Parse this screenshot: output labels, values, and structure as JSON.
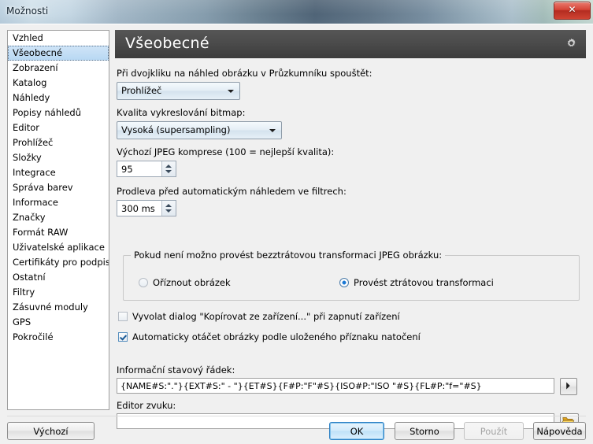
{
  "window": {
    "title": "Možnosti",
    "close_label": "✕",
    "close_icon": "close-icon"
  },
  "sidebar": {
    "items": [
      {
        "label": "Vzhled",
        "selected": false
      },
      {
        "label": "Všeobecné",
        "selected": true
      },
      {
        "label": "Zobrazení",
        "selected": false
      },
      {
        "label": "Katalog",
        "selected": false
      },
      {
        "label": "Náhledy",
        "selected": false
      },
      {
        "label": "Popisy náhledů",
        "selected": false
      },
      {
        "label": "Editor",
        "selected": false
      },
      {
        "label": "Prohlížeč",
        "selected": false
      },
      {
        "label": "Složky",
        "selected": false
      },
      {
        "label": "Integrace",
        "selected": false
      },
      {
        "label": "Správa barev",
        "selected": false
      },
      {
        "label": "Informace",
        "selected": false
      },
      {
        "label": "Značky",
        "selected": false
      },
      {
        "label": "Formát RAW",
        "selected": false
      },
      {
        "label": "Uživatelské aplikace",
        "selected": false
      },
      {
        "label": "Certifikáty pro podpis",
        "selected": false
      },
      {
        "label": "Ostatní",
        "selected": false
      },
      {
        "label": "Filtry",
        "selected": false
      },
      {
        "label": "Zásuvné moduly",
        "selected": false
      },
      {
        "label": "GPS",
        "selected": false
      },
      {
        "label": "Pokročilé",
        "selected": false
      }
    ]
  },
  "panel": {
    "title": "Všeobecné",
    "gear_icon": "gear-icon",
    "doubleclick": {
      "label": "Při dvojkliku na náhled obrázku v Průzkumníku spouštět:",
      "value": "Prohlížeč"
    },
    "bitmap_quality": {
      "label": "Kvalita vykreslování bitmap:",
      "value": "Vysoká (supersampling)"
    },
    "jpeg_compression": {
      "label": "Výchozí JPEG komprese (100 = nejlepší kvalita):",
      "value": "95"
    },
    "filter_delay": {
      "label": "Prodleva před automatickým náhledem ve filtrech:",
      "value": "300 ms"
    },
    "lossless_group": {
      "title": "Pokud není možno provést bezztrátovou transformaci JPEG obrázku:",
      "options": [
        {
          "label": "Oříznout obrázek",
          "selected": false
        },
        {
          "label": "Provést ztrátovou transformaci",
          "selected": true
        }
      ]
    },
    "checkboxes": [
      {
        "label": "Vyvolat dialog \"Kopírovat ze zařízení...\" při zapnutí zařízení",
        "checked": false
      },
      {
        "label": "Automaticky otáčet obrázky podle uloženého příznaku natočení",
        "checked": true
      }
    ],
    "status_line": {
      "label": "Informační stavový řádek:",
      "value": "{NAME#S:\".\"}{EXT#S:\" - \"}{ET#S}{F#P:\"F\"#S}{ISO#P:\"ISO \"#S}{FL#P:\"f=\"#S}",
      "button_icon": "play-arrow-icon"
    },
    "sound_editor": {
      "label": "Editor zvuku:",
      "value": "",
      "placeholder": "",
      "button_icon": "folder-open-icon"
    }
  },
  "footer": {
    "defaults_label": "Výchozí",
    "ok_label": "OK",
    "cancel_label": "Storno",
    "apply_label": "Použít",
    "help_label": "Nápověda"
  },
  "colors": {
    "dialog_bg": "#f0f0f0",
    "panel_header": "#4a4a4a",
    "selection": "#b8d8f3",
    "accent": "#1977d4",
    "close_red": "#d64436"
  }
}
